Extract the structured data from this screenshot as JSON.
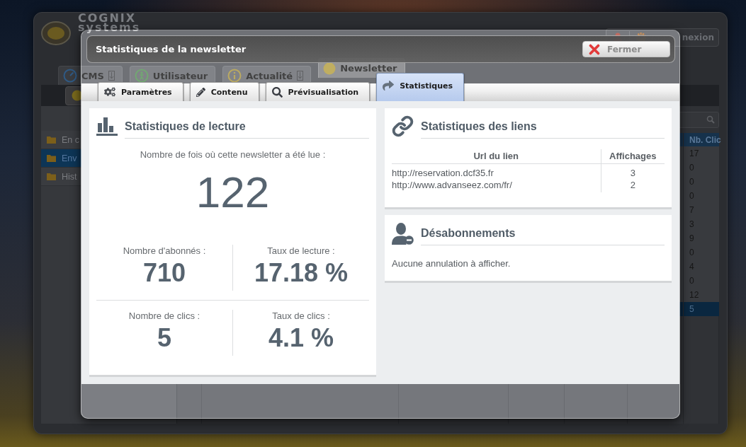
{
  "background_app": {
    "logo": {
      "name": "COGNIX",
      "tagline": "systems"
    },
    "logout_button": "nexion",
    "tabs": [
      {
        "label": "CMS",
        "selected": false
      },
      {
        "label": "Utilisateur",
        "selected": false
      },
      {
        "label": "Actualité",
        "selected": false
      },
      {
        "label": "Newsletter",
        "selected": true
      }
    ],
    "sidebar": [
      {
        "label": "En c",
        "selected": false
      },
      {
        "label": "Env",
        "selected": true
      },
      {
        "label": "Hist",
        "selected": false
      }
    ],
    "table": {
      "column": "Nb. Clic",
      "rows": [
        {
          "value": "17",
          "selected": false
        },
        {
          "value": "0",
          "selected": false
        },
        {
          "value": "0",
          "selected": false
        },
        {
          "value": "0",
          "selected": false
        },
        {
          "value": "7",
          "selected": false
        },
        {
          "value": "3",
          "selected": false
        },
        {
          "value": "9",
          "selected": false
        },
        {
          "value": "0",
          "selected": false
        },
        {
          "value": "4",
          "selected": false
        },
        {
          "value": "0",
          "selected": false
        },
        {
          "value": "12",
          "selected": false
        },
        {
          "value": "5",
          "selected": true
        }
      ]
    }
  },
  "dialog": {
    "title": "Statistiques de la newsletter",
    "close_button": "Fermer",
    "tabs": [
      {
        "label": "Paramètres",
        "selected": false
      },
      {
        "label": "Contenu",
        "selected": false
      },
      {
        "label": "Prévisualisation",
        "selected": false
      },
      {
        "label": "Statistiques",
        "selected": true
      }
    ],
    "reading_stats": {
      "title": "Statistiques de lecture",
      "reads_label": "Nombre de fois où cette newsletter a été lue :",
      "reads_value": "122",
      "metrics": [
        {
          "label": "Nombre d'abonnés :",
          "value": "710"
        },
        {
          "label": "Taux de lecture :",
          "value": "17.18 %"
        },
        {
          "label": "Nombre de clics :",
          "value": "5"
        },
        {
          "label": "Taux de clics :",
          "value": "4.1 %"
        }
      ]
    },
    "link_stats": {
      "title": "Statistiques des liens",
      "columns": [
        "Url du lien",
        "Affichages"
      ],
      "rows": [
        {
          "url": "http://reservation.dcf35.fr",
          "views": "3"
        },
        {
          "url": "http://www.advanseez.com/fr/",
          "views": "2"
        }
      ]
    },
    "unsubscriptions": {
      "title": "Désabonnements",
      "message": "Aucune annulation à afficher."
    }
  }
}
